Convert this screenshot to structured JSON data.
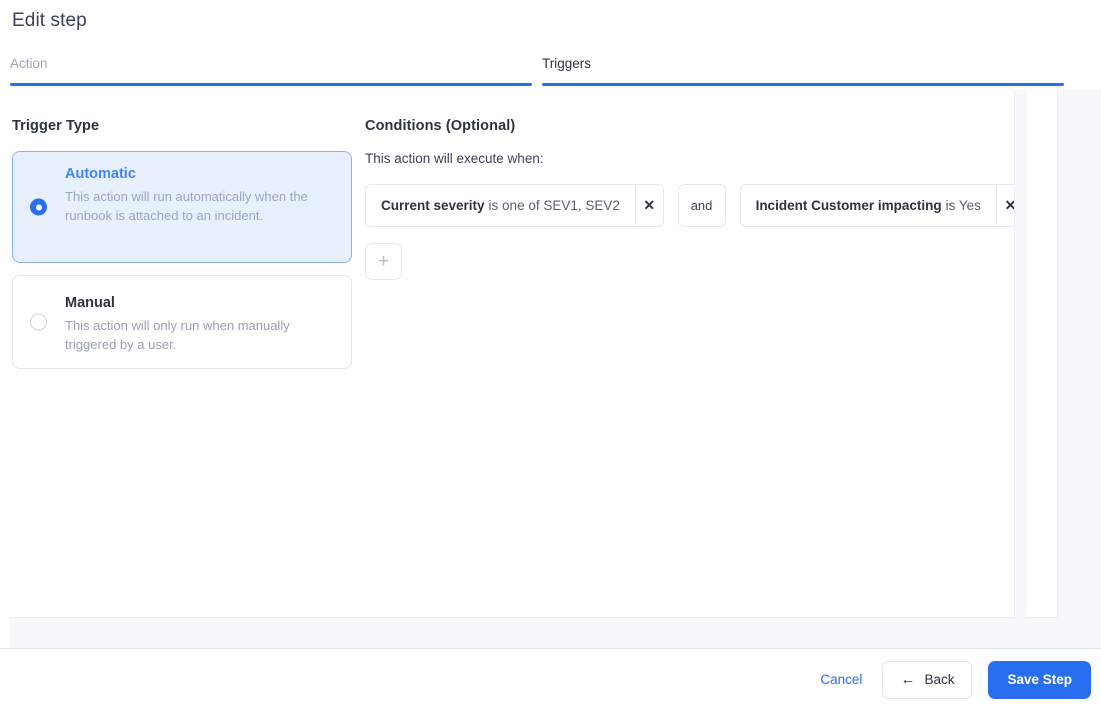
{
  "modal": {
    "title": "Edit step"
  },
  "tabs": [
    {
      "id": "action",
      "label": "Action",
      "active": false
    },
    {
      "id": "triggers",
      "label": "Triggers",
      "active": true
    }
  ],
  "trigger_type": {
    "heading": "Trigger Type",
    "options": [
      {
        "id": "automatic",
        "title": "Automatic",
        "description": "This action will run automatically when the runbook is attached to an incident.",
        "selected": true
      },
      {
        "id": "manual",
        "title": "Manual",
        "description": "This action will only run when manually triggered by a user.",
        "selected": false
      }
    ]
  },
  "conditions": {
    "heading": "Conditions (Optional)",
    "subtext": "This action will execute when:",
    "items": [
      {
        "field": "Current severity",
        "expression": "is one of SEV1, SEV2",
        "remove_label": "✕"
      },
      {
        "field": "Incident Customer impacting",
        "expression": "is Yes",
        "remove_label": "✕"
      }
    ],
    "connector": "and",
    "add_label": "+"
  },
  "footer": {
    "cancel_label": "Cancel",
    "back_arrow": "←",
    "back_label": "Back",
    "save_label": "Save Step"
  },
  "colors": {
    "accent": "#2a6ef0",
    "selected_card_bg": "#e8f0fe",
    "selected_card_border": "#8ab0f5",
    "text_primary": "#2e3340",
    "text_muted": "#9aa1b0"
  }
}
